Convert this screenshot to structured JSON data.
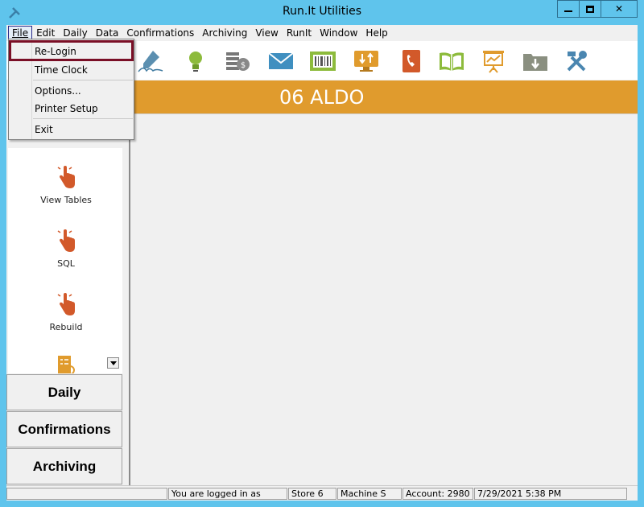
{
  "window": {
    "title": "Run.It Utilities",
    "app_icon": "tools-icon",
    "minimize_label": "—",
    "close_label": "✕"
  },
  "menubar": {
    "items": [
      {
        "label": "File"
      },
      {
        "label": "Edit"
      },
      {
        "label": "Daily"
      },
      {
        "label": "Data"
      },
      {
        "label": "Confirmations"
      },
      {
        "label": "Archiving"
      },
      {
        "label": "View"
      },
      {
        "label": "RunIt"
      },
      {
        "label": "Window"
      },
      {
        "label": "Help"
      }
    ]
  },
  "file_menu": {
    "items": [
      {
        "label": "Re-Login"
      },
      {
        "label": "Time Clock"
      },
      {
        "label": "Options..."
      },
      {
        "label": "Printer Setup"
      },
      {
        "label": "Exit"
      }
    ],
    "highlight_color": "#7a0f26"
  },
  "toolbar": {
    "icons": [
      "signature-icon",
      "lightbulb-icon",
      "money-icon",
      "mail-icon",
      "barcode-icon",
      "transfer-icon",
      "phonebook-icon",
      "book-icon",
      "presentation-icon",
      "download-folder-icon",
      "tools-icon"
    ]
  },
  "banner": {
    "text": "06 ALDO",
    "color": "#e09b2d"
  },
  "left_panel": {
    "tools": [
      {
        "label": "View Tables",
        "icon": "hand-pointer-icon"
      },
      {
        "label": "SQL",
        "icon": "hand-pointer-icon"
      },
      {
        "label": "Rebuild",
        "icon": "hand-pointer-icon"
      }
    ],
    "nav_buttons": [
      {
        "label": "Daily"
      },
      {
        "label": "Confirmations"
      },
      {
        "label": "Archiving"
      }
    ]
  },
  "statusbar": {
    "fields": [
      {
        "text": ""
      },
      {
        "text": "You are logged in as"
      },
      {
        "text": "Store 6"
      },
      {
        "text": "Machine S"
      },
      {
        "text": "Account: 2980"
      },
      {
        "text": "7/29/2021 5:38 PM"
      }
    ]
  }
}
